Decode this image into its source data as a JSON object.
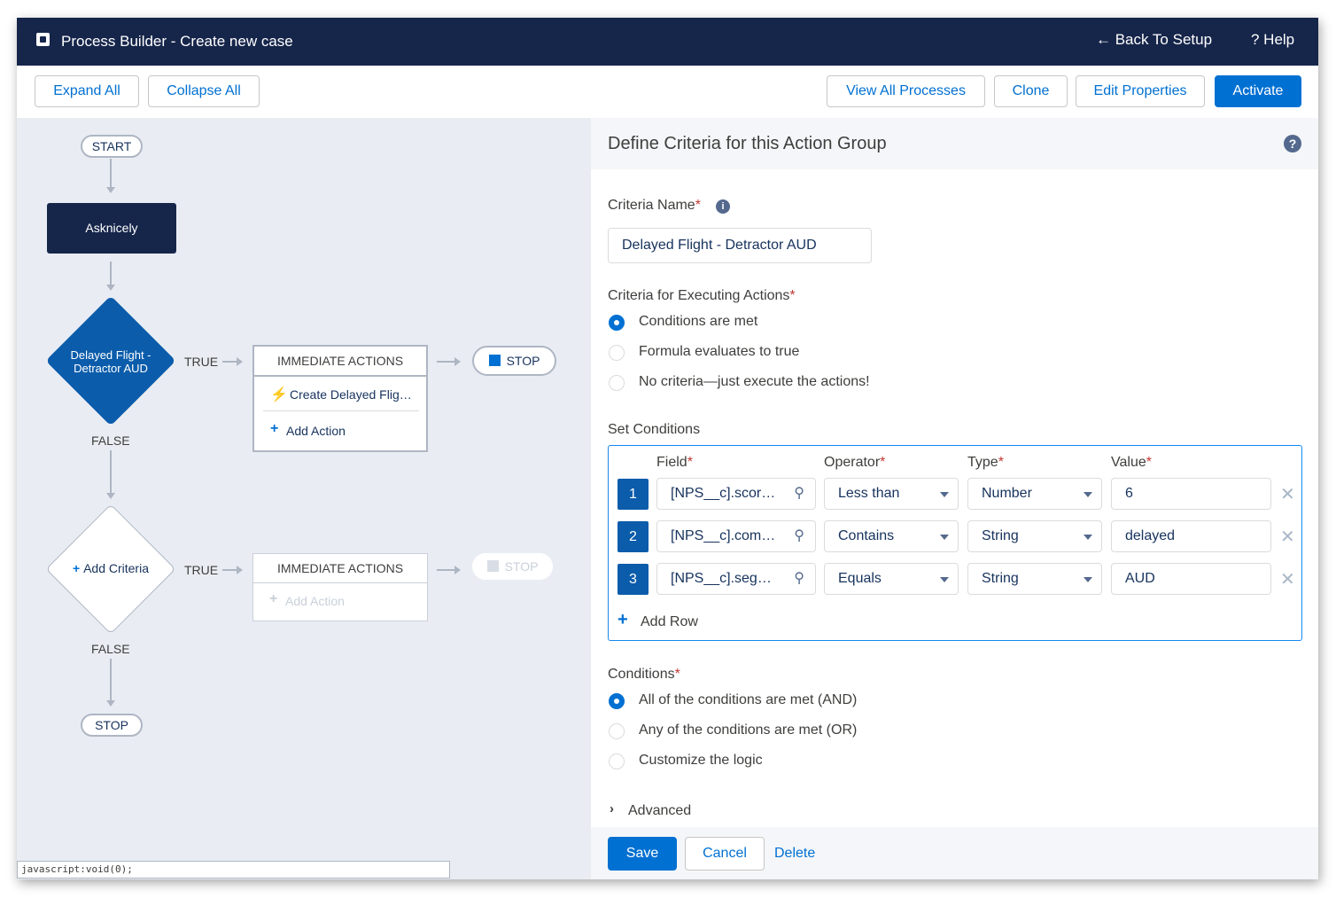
{
  "header": {
    "title": "Process Builder - Create new case",
    "back_to_setup": "← Back To Setup",
    "help": "? Help"
  },
  "toolbar": {
    "expand_all": "Expand All",
    "collapse_all": "Collapse All",
    "view_all_processes": "View All Processes",
    "clone": "Clone",
    "edit_properties": "Edit Properties",
    "activate": "Activate"
  },
  "canvas": {
    "start": "START",
    "object_node": "Asknicely",
    "criteria1": {
      "label": "Delayed Flight - Detractor AUD",
      "true_label": "TRUE",
      "false_label": "FALSE",
      "actions_header": "IMMEDIATE ACTIONS",
      "action_item": "Create Delayed Flig…",
      "add_action": "Add Action",
      "stop": "STOP"
    },
    "criteria2": {
      "label": "Add Criteria",
      "true_label": "TRUE",
      "false_label": "FALSE",
      "actions_header": "IMMEDIATE ACTIONS",
      "add_action": "Add Action",
      "stop": "STOP"
    },
    "end_stop": "STOP",
    "status_url": "javascript:void(0);"
  },
  "panel": {
    "title": "Define Criteria for this Action Group",
    "criteria_name_label": "Criteria Name",
    "criteria_name_value": "Delayed Flight - Detractor AUD",
    "executing_label": "Criteria for Executing Actions",
    "executing_options": [
      "Conditions are met",
      "Formula evaluates to true",
      "No criteria—just execute the actions!"
    ],
    "set_conditions_label": "Set Conditions",
    "columns": {
      "field": "Field",
      "operator": "Operator",
      "type": "Type",
      "value": "Value"
    },
    "rows": [
      {
        "num": "1",
        "field": "[NPS__c].scor…",
        "operator": "Less than",
        "type": "Number",
        "value": "6"
      },
      {
        "num": "2",
        "field": "[NPS__c].com…",
        "operator": "Contains",
        "type": "String",
        "value": "delayed"
      },
      {
        "num": "3",
        "field": "[NPS__c].seg…",
        "operator": "Equals",
        "type": "String",
        "value": "AUD"
      }
    ],
    "add_row": "Add Row",
    "conditions_label": "Conditions",
    "conditions_options": [
      "All of the conditions are met (AND)",
      "Any of the conditions are met (OR)",
      "Customize the logic"
    ],
    "advanced": "Advanced",
    "save": "Save",
    "cancel": "Cancel",
    "delete": "Delete"
  },
  "colors": {
    "navy": "#16254a",
    "brand": "#0070d2",
    "canvas_bg": "#e9edf3",
    "diamond": "#0b5cab"
  }
}
